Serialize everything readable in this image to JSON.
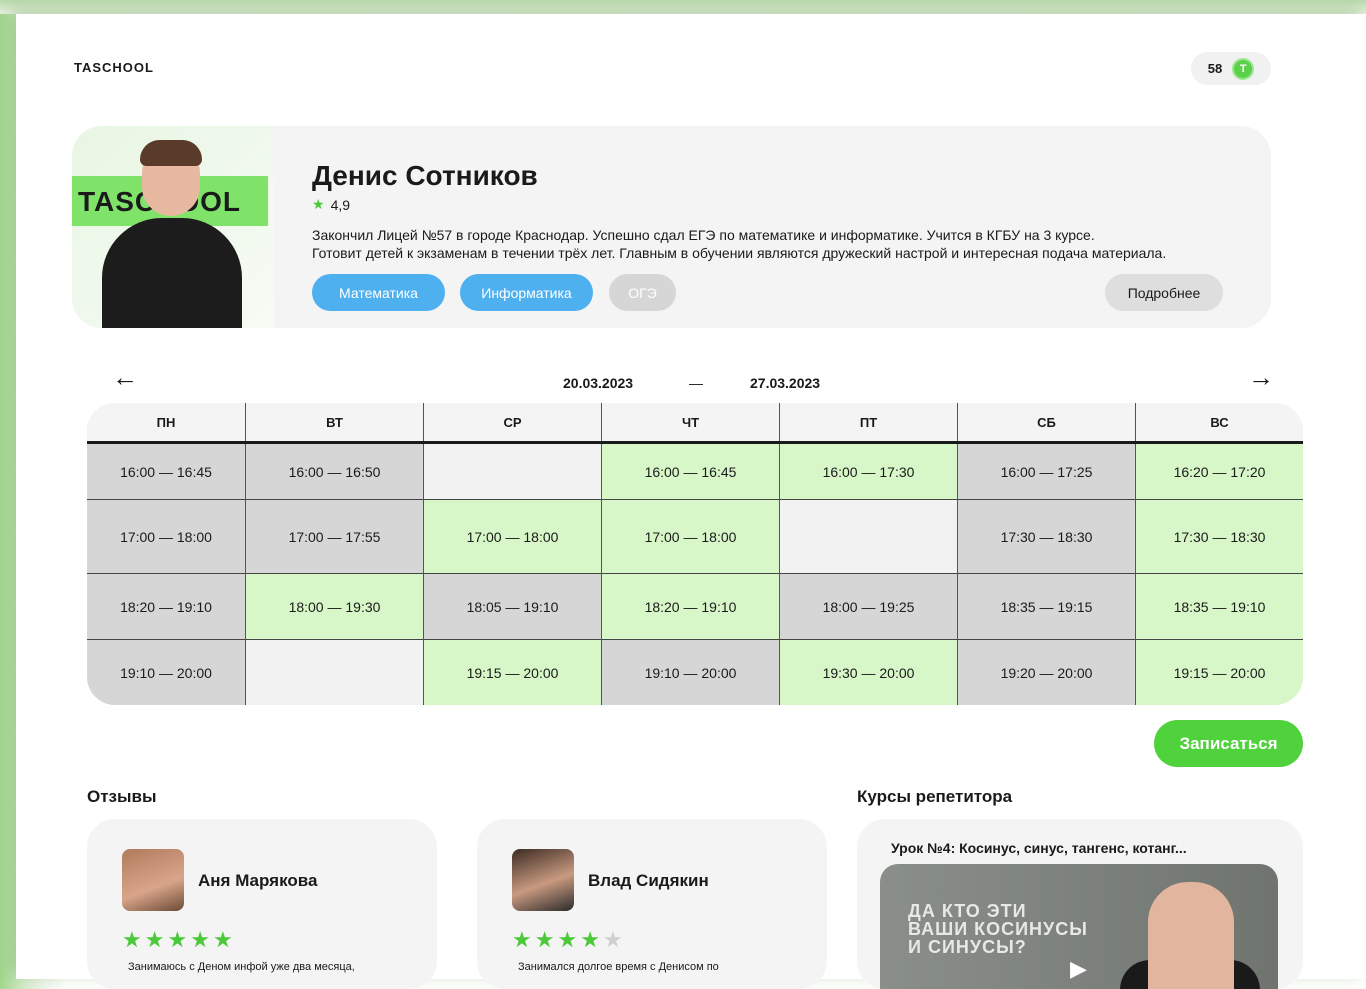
{
  "header": {
    "logo": "TASCHOOL",
    "coins": "58",
    "coin_letter": "T"
  },
  "tutor": {
    "name": "Денис Сотников",
    "rating": "4,9",
    "bio_line1": "Закончил Лицей №57 в городе Краснодар. Успешно сдал ЕГЭ по математике и информатике. Учится в КГБУ на 3 курсе.",
    "bio_line2": "Готовит детей к экзаменам в течении трёх лет. Главным в обучении являются дружеский настрой и интересная подача материала.",
    "photo_text": "TASCHOOL",
    "tags": [
      "Математика",
      "Информатика",
      "ОГЭ"
    ],
    "more_label": "Подробнее"
  },
  "schedule": {
    "date_from": "20.03.2023",
    "date_sep": "—",
    "date_to": "27.03.2023",
    "prev_arrow": "←",
    "next_arrow": "→",
    "days": [
      "ПН",
      "ВТ",
      "СР",
      "ЧТ",
      "ПТ",
      "СБ",
      "ВС"
    ],
    "columns": [
      [
        {
          "t": "16:00 — 16:45",
          "s": "b"
        },
        {
          "t": "17:00 — 18:00",
          "s": "b"
        },
        {
          "t": "18:20 — 19:10",
          "s": "b"
        },
        {
          "t": "19:10 — 20:00",
          "s": "b"
        }
      ],
      [
        {
          "t": "16:00 — 16:50",
          "s": "b"
        },
        {
          "t": "17:00 — 17:55",
          "s": "b"
        },
        {
          "t": "18:00 — 19:30",
          "s": "g"
        },
        {
          "t": "",
          "s": "e"
        }
      ],
      [
        {
          "t": "",
          "s": "e"
        },
        {
          "t": "17:00 — 18:00",
          "s": "g"
        },
        {
          "t": "18:05 — 19:10",
          "s": "b"
        },
        {
          "t": "19:15 — 20:00",
          "s": "g"
        }
      ],
      [
        {
          "t": "16:00 — 16:45",
          "s": "g"
        },
        {
          "t": "17:00 — 18:00",
          "s": "g"
        },
        {
          "t": "18:20 — 19:10",
          "s": "g"
        },
        {
          "t": "19:10 — 20:00",
          "s": "b"
        }
      ],
      [
        {
          "t": "16:00 — 17:30",
          "s": "g"
        },
        {
          "t": "",
          "s": "e"
        },
        {
          "t": "18:00 — 19:25",
          "s": "b"
        },
        {
          "t": "19:30 — 20:00",
          "s": "g"
        }
      ],
      [
        {
          "t": "16:00 — 17:25",
          "s": "b"
        },
        {
          "t": "17:30 — 18:30",
          "s": "b"
        },
        {
          "t": "18:35 — 19:15",
          "s": "b"
        },
        {
          "t": "19:20 — 20:00",
          "s": "b"
        }
      ],
      [
        {
          "t": "16:20 — 17:20",
          "s": "g"
        },
        {
          "t": "17:30 — 18:30",
          "s": "g"
        },
        {
          "t": "18:35 — 19:10",
          "s": "g"
        },
        {
          "t": "19:15 — 20:00",
          "s": "g"
        }
      ]
    ]
  },
  "signup_label": "Записаться",
  "reviews": {
    "title": "Отзывы",
    "items": [
      {
        "name": "Аня Марякова",
        "stars": 5,
        "text": "Занимаюсь с Деном инфой уже два месяца,"
      },
      {
        "name": "Влад Сидякин",
        "stars": 4,
        "text": "Занимался долгое время с Денисом по"
      }
    ]
  },
  "courses": {
    "title": "Курсы репетитора",
    "item_title": "Урок №4: Косинус, синус, тангенс, котанг...",
    "video_line1": "ДА КТО ЭТИ",
    "video_line2": "ВАШИ КОСИНУСЫ",
    "video_line3": "И СИНУСЫ?"
  },
  "colors": {
    "accent_green": "#4fd23b",
    "tag_blue": "#4fb0f0",
    "slot_green": "#d8f7c8",
    "slot_gray": "#d6d6d6"
  }
}
